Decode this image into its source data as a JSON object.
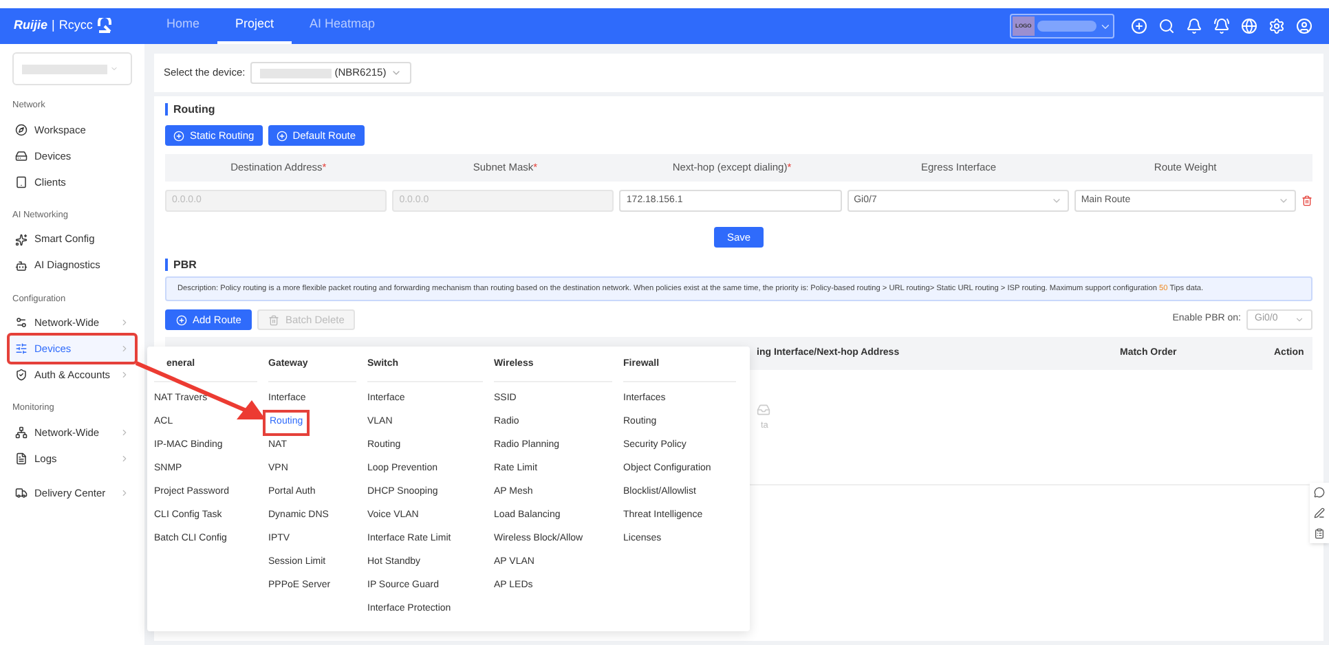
{
  "top_nav": {
    "brand": "Ruijie",
    "separator": "|",
    "product": "Rcycc",
    "tabs": [
      {
        "label": "Home",
        "selected": false
      },
      {
        "label": "Project",
        "selected": true
      },
      {
        "label": "AI Heatmap",
        "selected": false
      }
    ],
    "org_logo": "LOGO"
  },
  "sidebar": {
    "sections": [
      {
        "title": "Network",
        "items": [
          {
            "label": "Workspace",
            "has_submenu": false,
            "selected": false,
            "annotated": false
          },
          {
            "label": "Devices",
            "has_submenu": false,
            "selected": false,
            "annotated": false
          },
          {
            "label": "Clients",
            "has_submenu": false,
            "selected": false,
            "annotated": false
          }
        ]
      },
      {
        "title": "AI Networking",
        "items": [
          {
            "label": "Smart Config",
            "has_submenu": false,
            "selected": false,
            "annotated": false
          },
          {
            "label": "AI Diagnostics",
            "has_submenu": false,
            "selected": false,
            "annotated": false
          }
        ]
      },
      {
        "title": "Configuration",
        "items": [
          {
            "label": "Network-Wide",
            "has_submenu": true,
            "selected": false,
            "annotated": false
          },
          {
            "label": "Devices",
            "has_submenu": true,
            "selected": true,
            "annotated": true
          },
          {
            "label": "Auth & Accounts",
            "has_submenu": true,
            "selected": false,
            "annotated": false
          }
        ]
      },
      {
        "title": "Monitoring",
        "items": [
          {
            "label": "Network-Wide",
            "has_submenu": true,
            "selected": false,
            "annotated": false
          },
          {
            "label": "Logs",
            "has_submenu": true,
            "selected": false,
            "annotated": false
          },
          {
            "label": "Delivery Center",
            "has_submenu": true,
            "selected": false,
            "annotated": false
          }
        ]
      }
    ]
  },
  "device_select": {
    "label": "Select the device:",
    "value": "(NBR6215)"
  },
  "routing": {
    "title": "Routing",
    "required_mark": "*",
    "buttons": [
      "Static Routing",
      "Default Route"
    ],
    "columns": [
      {
        "label": "Destination Address",
        "required": true
      },
      {
        "label": "Subnet Mask",
        "required": true
      },
      {
        "label": "Next-hop (except dialing)",
        "required": true
      },
      {
        "label": "Egress Interface",
        "required": false
      },
      {
        "label": "Route Weight",
        "required": false
      }
    ],
    "cells": [
      {
        "kind": "input",
        "value": "0.0.0.0",
        "disabled": true
      },
      {
        "kind": "input",
        "value": "0.0.0.0",
        "disabled": true
      },
      {
        "kind": "input",
        "value": "172.18.156.1",
        "disabled": false
      },
      {
        "kind": "select",
        "value": "Gi0/7",
        "disabled": false
      },
      {
        "kind": "select",
        "value": "Main Route",
        "disabled": false
      }
    ],
    "save": "Save"
  },
  "pbr": {
    "title": "PBR",
    "description": "Description: Policy routing is a more flexible packet routing and forwarding mechanism than routing based on the destination network. When policies exist at the same time, the priority is: Policy-based routing > URL routing> Static URL routing > ISP routing. Maximum support configuration ",
    "count": "50",
    "description_end": " Tips data.",
    "buttons": [
      {
        "label": "Add Route",
        "disabled": false
      },
      {
        "label": "Batch Delete",
        "disabled": true
      }
    ],
    "enable_label": "Enable PBR on:",
    "enable_value": "Gi0/0",
    "columns": [
      "ing Interface/Next-hop Address",
      "Match Order",
      "Action"
    ],
    "empty_text": "ta"
  },
  "menu": {
    "columns": [
      {
        "title": "eneral",
        "items": [
          {
            "label": "NAT Travers",
            "selected": false
          },
          {
            "label": "ACL",
            "selected": false
          },
          {
            "label": "IP-MAC Binding",
            "selected": false
          },
          {
            "label": "SNMP",
            "selected": false
          },
          {
            "label": "Project Password",
            "selected": false
          },
          {
            "label": "CLI Config Task",
            "selected": false
          },
          {
            "label": "Batch CLI Config",
            "selected": false
          }
        ]
      },
      {
        "title": "Gateway",
        "items": [
          {
            "label": "Interface",
            "selected": false
          },
          {
            "label": "Routing",
            "selected": true
          },
          {
            "label": "NAT",
            "selected": false
          },
          {
            "label": "VPN",
            "selected": false
          },
          {
            "label": "Portal Auth",
            "selected": false
          },
          {
            "label": "Dynamic DNS",
            "selected": false
          },
          {
            "label": "IPTV",
            "selected": false
          },
          {
            "label": "Session Limit",
            "selected": false
          },
          {
            "label": "PPPoE Server",
            "selected": false
          }
        ]
      },
      {
        "title": "Switch",
        "items": [
          {
            "label": "Interface",
            "selected": false
          },
          {
            "label": "VLAN",
            "selected": false
          },
          {
            "label": "Routing",
            "selected": false
          },
          {
            "label": "Loop Prevention",
            "selected": false
          },
          {
            "label": "DHCP Snooping",
            "selected": false
          },
          {
            "label": "Voice VLAN",
            "selected": false
          },
          {
            "label": "Interface Rate Limit",
            "selected": false
          },
          {
            "label": "Hot Standby",
            "selected": false
          },
          {
            "label": "IP Source Guard",
            "selected": false
          },
          {
            "label": "Interface Protection",
            "selected": false
          }
        ]
      },
      {
        "title": "Wireless",
        "items": [
          {
            "label": "SSID",
            "selected": false
          },
          {
            "label": "Radio",
            "selected": false
          },
          {
            "label": "Radio Planning",
            "selected": false
          },
          {
            "label": "Rate Limit",
            "selected": false
          },
          {
            "label": "AP Mesh",
            "selected": false
          },
          {
            "label": "Load Balancing",
            "selected": false
          },
          {
            "label": "Wireless Block/Allow",
            "selected": false
          },
          {
            "label": "AP VLAN",
            "selected": false
          },
          {
            "label": "AP LEDs",
            "selected": false
          }
        ]
      },
      {
        "title": "Firewall",
        "items": [
          {
            "label": "Interfaces",
            "selected": false
          },
          {
            "label": "Routing",
            "selected": false
          },
          {
            "label": "Security Policy",
            "selected": false
          },
          {
            "label": "Object Configuration",
            "selected": false
          },
          {
            "label": "Blocklist/Allowlist",
            "selected": false
          },
          {
            "label": "Threat Intelligence",
            "selected": false
          },
          {
            "label": "Licenses",
            "selected": false
          }
        ]
      }
    ]
  }
}
